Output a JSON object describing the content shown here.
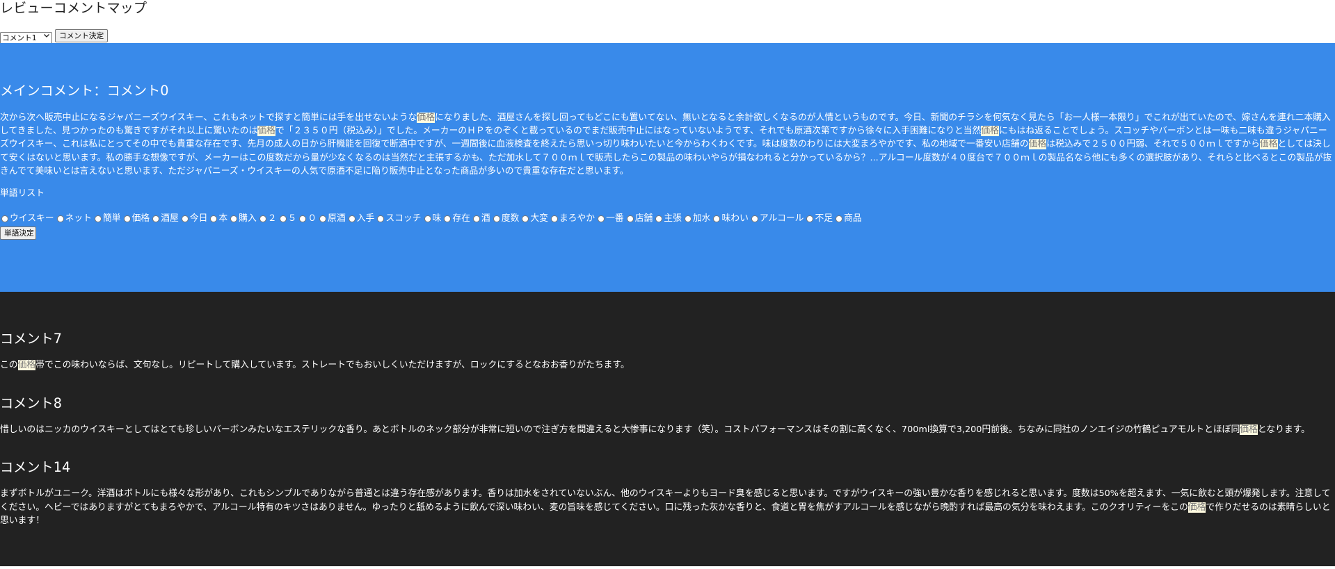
{
  "page": {
    "title": "レビューコメントマップ"
  },
  "comment_selector": {
    "selected": "コメント1",
    "arrow_icon": "chevron-down-icon",
    "submit_label": "コメント決定"
  },
  "highlight_word": "価格",
  "main_comment": {
    "heading": "メインコメント：コメント0",
    "text": "次から次へ販売中止になるジャパニーズウイスキー、これもネットで探すと簡単には手を出せないような価格になりました、酒屋さんを探し回ってもどこにも置いてない、無いとなると余計欲しくなるのが人情というものです。今日、新聞のチラシを何気なく見たら「お一人様一本限り」でこれが出ていたので、嫁さんを連れ二本購入してきました、見つかったのも驚きですがそれ以上に驚いたのは価格で「２３５０円（税込み）」でした。メーカーのＨＰをのぞくと載っているのでまだ販売中止にはなっていないようです、それでも原酒次第ですから徐々に入手困難になりと当然価格にもはね返ることでしょう。スコッチやバーボンとは一味も二味も違うジャパニーズウイスキー、これは私にとってその中でも貴重な存在です、先月の成人の日から肝機能を回復で断酒中ですが、一週間後に血液検査を終えたら思いっ切り味わいたいと今からわくわくです。味は度数のわりには大変まろやかです、私の地域で一番安い店舗の価格は税込みで２５００円弱、それで５００ｍｌですから価格としては決して安くはないと思います。私の勝手な想像ですが、メーカーはこの度数だから量が少なくなるのは当然だと主張するかも、ただ加水して７００ｍｌで販売したらこの製品の味わいやらが損なわれると分かっているから？...アルコール度数が４０度台で７００ｍｌの製品名なら他にも多くの選択肢があり、それらと比べるとこの製品が抜きんでて美味いとは言えないと思います、ただジャパニーズ・ウイスキーの人気で原酒不足に陥り販売中止となった商品が多いので貴重な存在だと思います。"
  },
  "word_list": {
    "heading": "単語リスト",
    "words": [
      "ウイスキー",
      "ネット",
      "簡単",
      "価格",
      "酒屋",
      "今日",
      "本",
      "購入",
      "２",
      "５",
      "０",
      "原酒",
      "入手",
      "スコッチ",
      "味",
      "存在",
      "酒",
      "度数",
      "大変",
      "まろやか",
      "一番",
      "店舗",
      "主張",
      "加水",
      "味わい",
      "アルコール",
      "不足",
      "商品"
    ],
    "submit_label": "単語決定"
  },
  "comments": [
    {
      "title": "コメント7",
      "text": "この価格帯でこの味わいならば、文句なし。リピートして購入しています。ストレートでもおいしくいただけますが、ロックにするとなおお香りがたちます。"
    },
    {
      "title": "コメント8",
      "text": "惜しいのはニッカのウイスキーとしてはとても珍しいバーボンみたいなエステリックな香り。あとボトルのネック部分が非常に短いので注ぎ方を間違えると大惨事になります（笑）。コストパフォーマンスはその割に高くなく、700ml換算で3,200円前後。ちなみに同社のノンエイジの竹鶴ピュアモルトとほぼ同価格となります。"
    },
    {
      "title": "コメント14",
      "text": "まずボトルがユニーク。洋酒はボトルにも様々な形があり、これもシンプルでありながら普通とは違う存在感があります。香りは加水をされていないぶん、他のウイスキーよりもヨード臭を感じると思います。ですがウイスキーの強い豊かな香りを感じれると思います。度数は50%を超えます、一気に飲むと頭が爆発します。注意してください。ヘビーではありますがとてもまろやかで、アルコール特有のキツさはありません。ゆったりと舐めるように飲んで深い味わい、麦の旨味を感じてください。口に残った灰かな香りと、食道と胃を焦がすアルコールを感じながら晩酌すれば最高の気分を味わえます。このクオリティーをこの価格で作りだせるのは素晴らしいと思います！"
    }
  ],
  "colors": {
    "main_bg": "#398aea",
    "comments_bg": "#222222",
    "highlight_bg": "#fffbe0"
  }
}
